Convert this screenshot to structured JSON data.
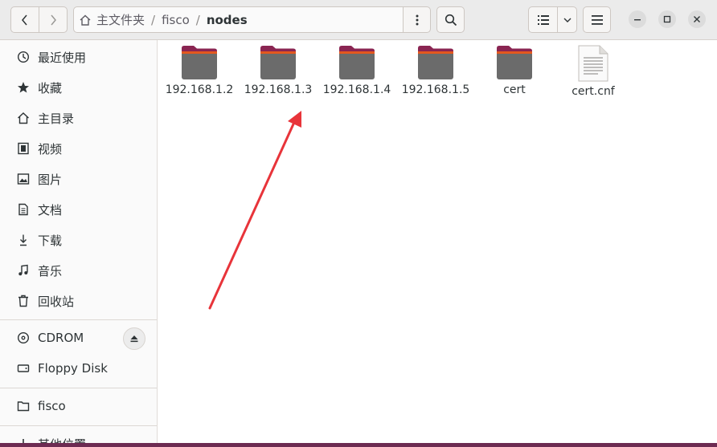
{
  "header": {
    "breadcrumbs": [
      "主文件夹",
      "fisco",
      "nodes"
    ],
    "separator": "/"
  },
  "sidebar": {
    "places": [
      {
        "label": "最近使用",
        "icon": "clock-icon"
      },
      {
        "label": "收藏",
        "icon": "star-icon"
      },
      {
        "label": "主目录",
        "icon": "home-icon"
      },
      {
        "label": "视频",
        "icon": "video-icon"
      },
      {
        "label": "图片",
        "icon": "image-icon"
      },
      {
        "label": "文档",
        "icon": "document-icon"
      },
      {
        "label": "下载",
        "icon": "download-icon"
      },
      {
        "label": "音乐",
        "icon": "music-icon"
      },
      {
        "label": "回收站",
        "icon": "trash-icon"
      }
    ],
    "devices": [
      {
        "label": "CDROM",
        "icon": "disc-icon"
      },
      {
        "label": "Floppy Disk",
        "icon": "drive-icon"
      }
    ],
    "bookmarks": [
      {
        "label": "fisco",
        "icon": "folder-icon"
      }
    ],
    "other": "其他位置"
  },
  "files": [
    {
      "name": "192.168.1.2",
      "type": "folder"
    },
    {
      "name": "192.168.1.3",
      "type": "folder"
    },
    {
      "name": "192.168.1.4",
      "type": "folder"
    },
    {
      "name": "192.168.1.5",
      "type": "folder"
    },
    {
      "name": "cert",
      "type": "folder"
    },
    {
      "name": "cert.cnf",
      "type": "text-file"
    }
  ],
  "colors": {
    "annotation_arrow": "#e8343a",
    "folder_body": "#6b6b6b",
    "folder_tab": "#8a2552"
  }
}
